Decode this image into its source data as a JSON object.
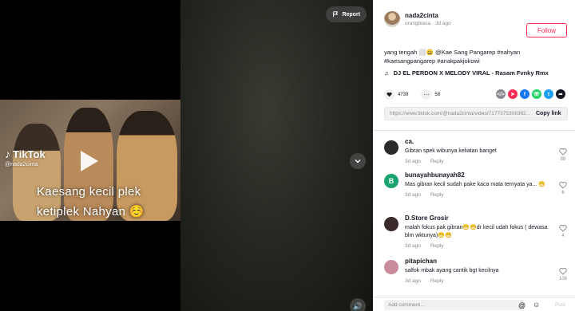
{
  "video": {
    "brand": "TikTok",
    "handle": "@nada2cinta",
    "caption_line1": "Kaesang kecil plek",
    "caption_line2": "ketiplek Nahyan ☺️",
    "report_label": "Report"
  },
  "author": {
    "username": "nada2cinta",
    "subtitle": "orangbiasa · 3d ago",
    "follow_label": "Follow"
  },
  "post": {
    "description_line1": "yang tengah ⬜️😀 @Kae Sang Pangarep #nahyan",
    "description_line2": "#kaesangpangarep #anakpakjokowi",
    "music": "DJ EL PERDON X MELODY VIRAL - Rasam Fvnky Rmx",
    "likes": "4739",
    "comments": "58",
    "link_url": "https://www.tiktok.com/@nada2cinta/video/7177375308382...",
    "copy_label": "Copy link"
  },
  "comments": [
    {
      "user": "ca.",
      "text": "Gibran spek wibunya keliatan banget",
      "time": "3d ago",
      "reply": "Reply",
      "likes": "88",
      "avatar_color": "#2b2b2b"
    },
    {
      "user": "bunayahbunayah82",
      "text": "Mas gibran kecil sudah pake kaca mata ternyata ya... 😁",
      "time": "3d ago",
      "reply": "Reply",
      "likes": "6",
      "avatar_color": "#1aa36f",
      "avatar_letter": "B"
    },
    {
      "user": "D.Store Grosir",
      "text": "malah fokus pak gibran😁😁dr kecil udah fokus ( dewasa blm wktunya)😁😁",
      "time": "3d ago",
      "reply": "Reply",
      "likes": "4",
      "avatar_color": "#3a2a2a"
    },
    {
      "user": "pitapichan",
      "text": "salfok mbak ayang cantik bgt kecilnya",
      "time": "3d ago",
      "reply": "Reply",
      "likes": "108",
      "avatar_color": "#c98c9a"
    }
  ],
  "add_comment": {
    "placeholder": "Add comment...",
    "post_label": "Post"
  },
  "colors": {
    "accent": "#fe2c55",
    "muted": "#8a8b91"
  }
}
